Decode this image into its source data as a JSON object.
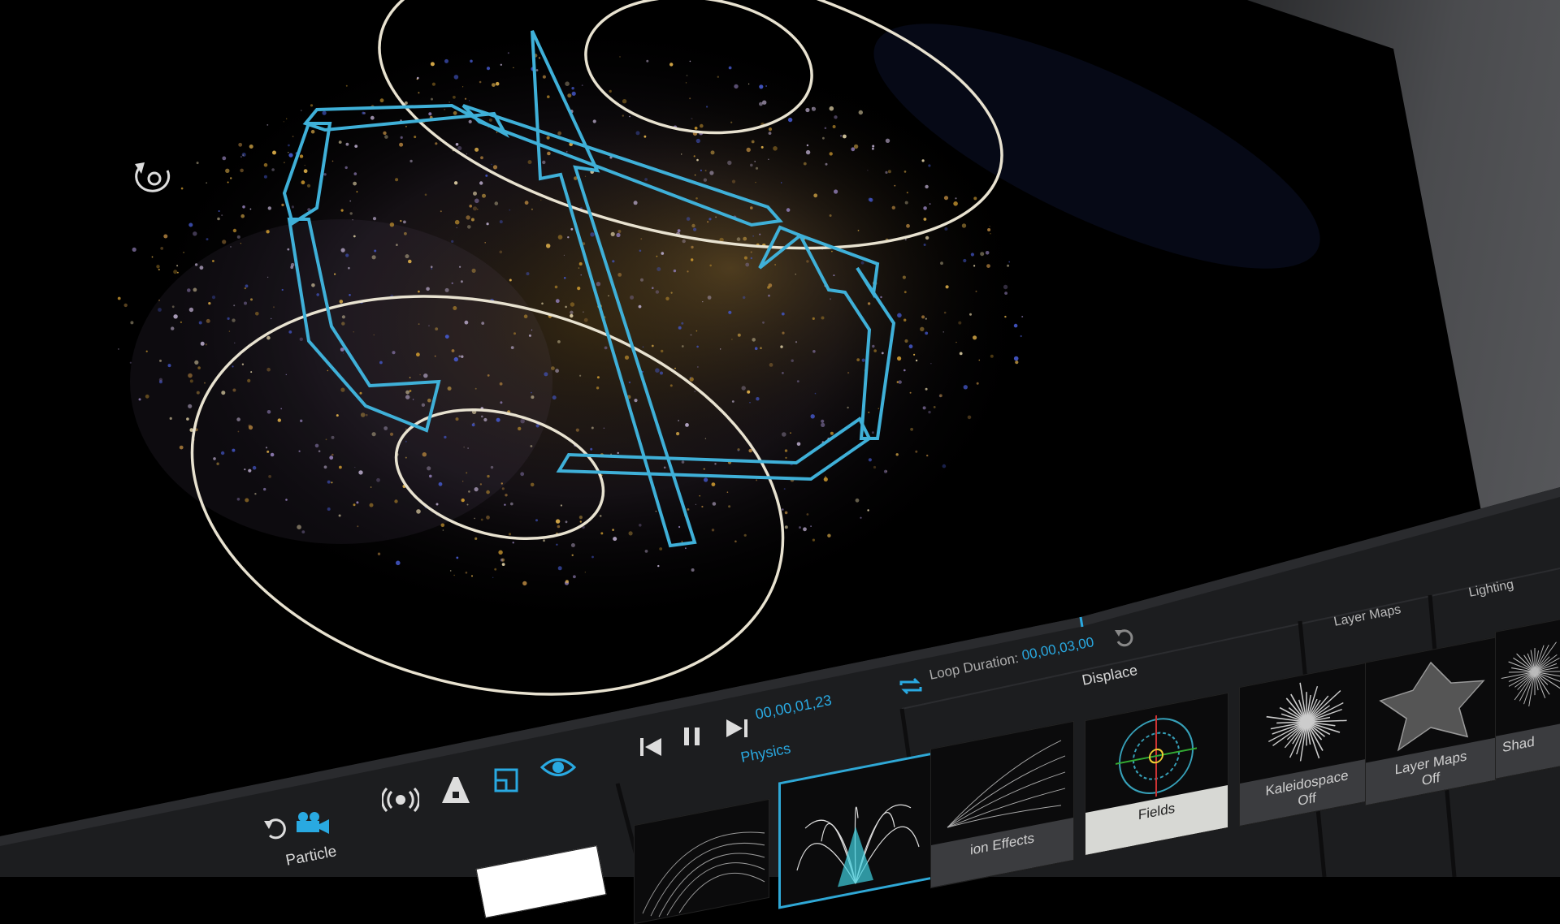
{
  "transport": {
    "time": "00,00,01,23",
    "loop_label": "Loop Duration:",
    "loop_value": "00,00,03,00"
  },
  "sections": {
    "particle": "Particle",
    "physics": "Physics",
    "displace": "Displace",
    "layer_maps": "Layer Maps",
    "lighting": "Lighting"
  },
  "thumbs": {
    "effects_caption": "ion Effects",
    "fields_caption": "Fields",
    "kaleido_caption": "Kaleidospace",
    "kaleido_state": "Off",
    "layermaps_caption": "Layer Maps",
    "layermaps_state": "Off",
    "shadow_caption": "Shad"
  },
  "colors": {
    "accent": "#29a9e1",
    "panel": "#1c1d1f",
    "guide": "#e8e2d0"
  },
  "icons": [
    "rotate-gizmo-icon",
    "undo-icon",
    "camera-icon",
    "broadcast-icon",
    "aux-icon",
    "frame-icon",
    "eye-icon",
    "skip-back-icon",
    "pause-icon",
    "skip-forward-icon",
    "loop-icon",
    "reset-icon"
  ]
}
